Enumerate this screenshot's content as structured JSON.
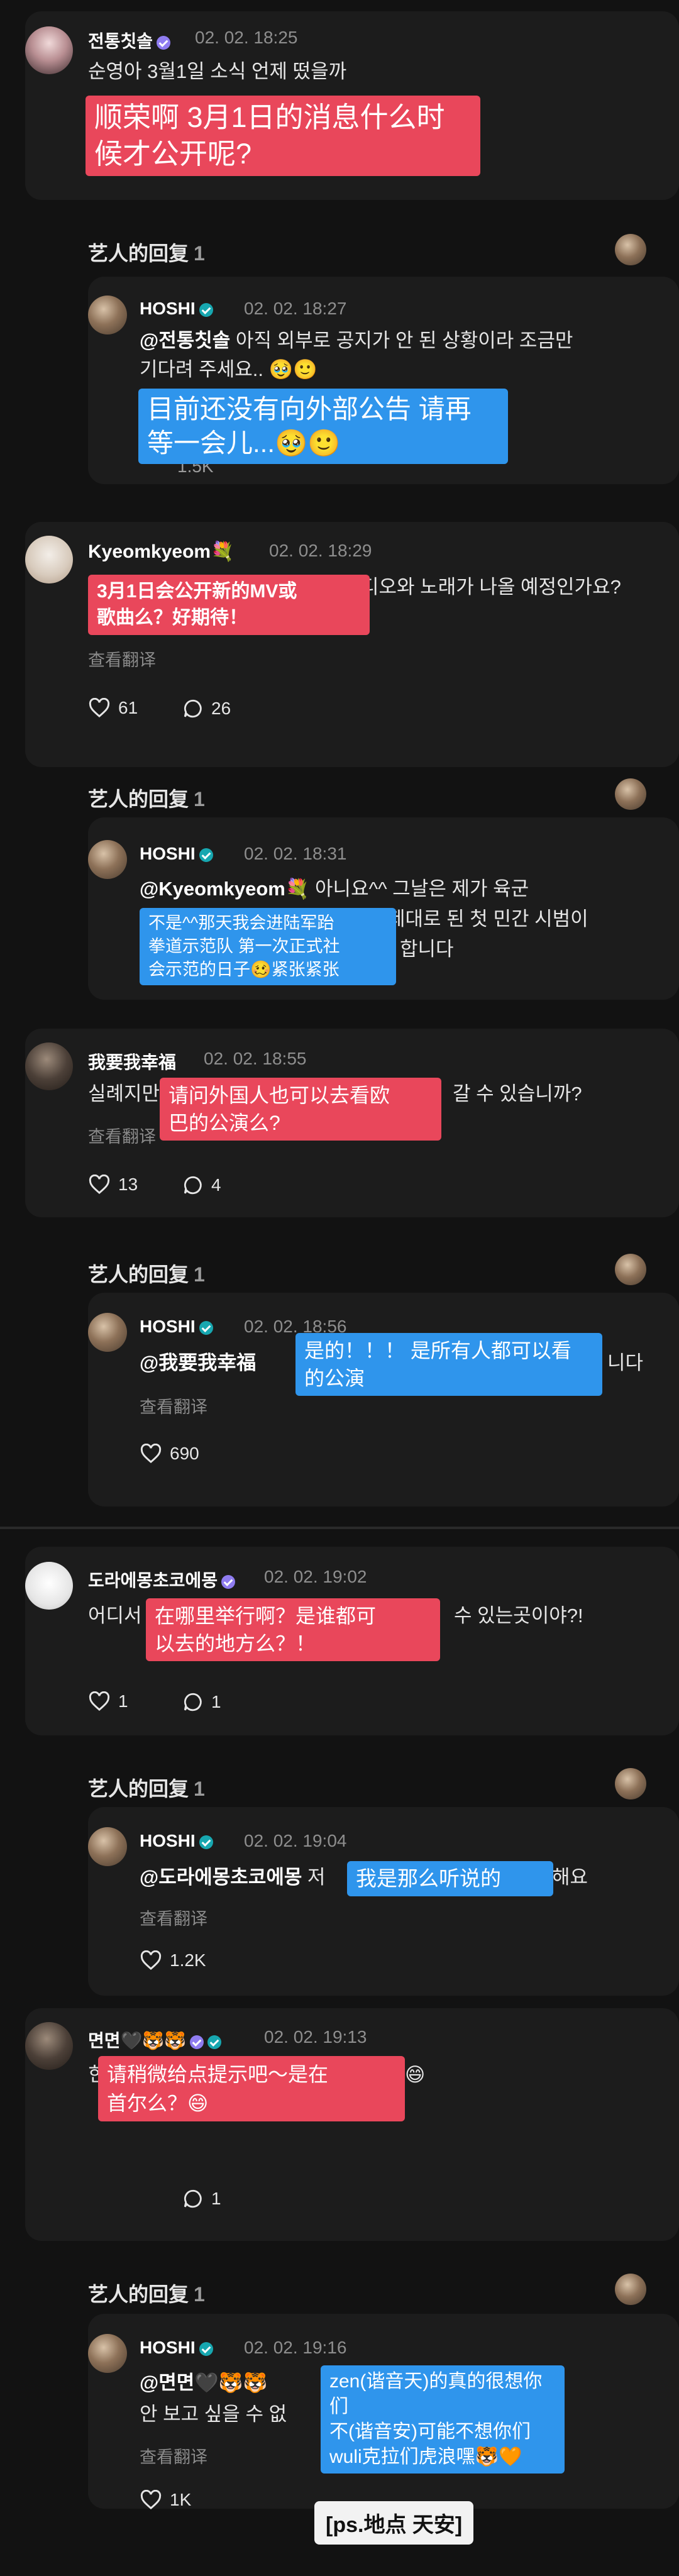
{
  "threads": [
    {
      "comment": {
        "user": "전통칫솔",
        "time": "02. 02. 18:25",
        "text": "순영아 3월1일 소식 언제 떴을까",
        "overlay_cn": "顺荣啊 3月1日的消息什么时\n候才公开呢?"
      },
      "artist_reply_label": "艺人的回复",
      "artist_reply_count": "1",
      "reply": {
        "user": "HOSHI",
        "time": "02. 02. 18:27",
        "mention": "@전통칫솔",
        "text_l1": " 아직 외부로 공지가 안 된 상황이라 조금만",
        "text_l2": "기다려 주세요.. 🥹🙂",
        "overlay_cn": "目前还没有向外部公告  请再\n等一会儿...🥹🙂",
        "likes_partial": "1.5K"
      }
    },
    {
      "comment": {
        "user": "Kyeomkyeom",
        "user_emoji": "💐",
        "time": "02. 02. 18:29",
        "text_tail": "디오와 노래가 나올 예정인가요?",
        "overlay_cn": "3月1日会公开新的MV或\n歌曲么？好期待！",
        "translate": "查看翻译",
        "likes": "61",
        "comments": "26"
      },
      "artist_reply_label": "艺人的回复",
      "artist_reply_count": "1",
      "reply": {
        "user": "HOSHI",
        "time": "02. 02. 18:31",
        "mention": "@Kyeomkyeom💐",
        "text_l1": " 아니요^^ 그날은 제가 육군",
        "text_l2_tail": "제대로 된 첫 민간 시범이",
        "text_l3_tail": "합니다",
        "overlay_cn": "不是^^那天我会进陆军跆\n拳道示范队 第一次正式社\n会示范的日子🥴紧张紧张"
      }
    },
    {
      "comment": {
        "user": "我要我幸福",
        "time": "02. 02. 18:55",
        "text_head": "실례지만",
        "text_tail": "갈 수 있습니까?",
        "overlay_cn": "请问外国人也可以去看欧\n巴的公演么?",
        "translate": "查看翻译",
        "likes": "13",
        "comments": "4"
      },
      "artist_reply_label": "艺人的回复",
      "artist_reply_count": "1",
      "reply": {
        "user": "HOSHI",
        "time": "02. 02. 18:56",
        "mention": "@我要我幸福",
        "text_tail": "니다",
        "overlay_cn": "是的！！！ 是所有人都可以看\n的公演",
        "translate": "查看翻译",
        "likes": "690"
      }
    },
    {
      "comment": {
        "user": "도라에몽초코에몽",
        "time": "02. 02. 19:02",
        "text_head": "어디서",
        "text_tail": "수 있는곳이야?!",
        "overlay_cn": "在哪里举行啊？是谁都可\n以去的地方么？！",
        "likes": "1",
        "comments": "1"
      },
      "artist_reply_label": "艺人的回复",
      "artist_reply_count": "1",
      "reply": {
        "user": "HOSHI",
        "time": "02. 02. 19:04",
        "mention": "@도라에몽초코에몽",
        "text_head2": "저",
        "text_tail": "해요",
        "overlay_cn": "我是那么听说的",
        "translate": "查看翻译",
        "likes": "1.2K"
      }
    },
    {
      "comment": {
        "user": "면면",
        "user_emoji": "🖤🐯🐯",
        "time": "02. 02. 19:13",
        "text_head": "힌",
        "text_tail": "😄",
        "overlay_cn": "请稍微给点提示吧～是在\n首尔么？😄",
        "comments": "1"
      },
      "artist_reply_label": "艺人的回复",
      "artist_reply_count": "1",
      "reply": {
        "user": "HOSHI",
        "time": "02. 02. 19:16",
        "mention": "@면면",
        "mention_emoji": "🖤🐯🐯",
        "text_l2_head": "안 보고 싶을 수 없",
        "overlay_cn": "zen(谐音天)的真的很想你\n们\n不(谐音安)可能不想你们\nwuli克拉们虎浪嘿🐯🧡",
        "translate": "查看翻译",
        "likes": "1K",
        "ps_note": "[ps.地点 天安]"
      }
    }
  ],
  "colors": {
    "background": "#121212",
    "card": "#1c1c1c",
    "overlay_red": "#e9475b",
    "overlay_blue": "#2f95ec",
    "verified_purple": "#8f7cf0",
    "verified_teal": "#17a7b0"
  },
  "icons": [
    "heart-icon",
    "comment-bubble-icon",
    "verified-badge-icon",
    "avatar"
  ]
}
